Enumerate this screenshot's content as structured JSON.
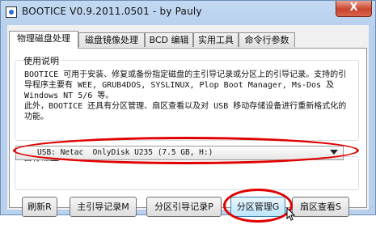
{
  "window": {
    "title": "BOOTICE V0.9.2011.0501 - by Pauly",
    "close_label": "X"
  },
  "tabs": [
    {
      "label": "物理磁盘处理",
      "active": true
    },
    {
      "label": "磁盘镜像处理",
      "active": false
    },
    {
      "label": "BCD 编辑",
      "active": false
    },
    {
      "label": "实用工具",
      "active": false
    },
    {
      "label": "命令行参数",
      "active": false
    }
  ],
  "usage": {
    "label": "使用说明",
    "text": "BOOTICE 可用于安装、修复或备份指定磁盘的主引导记录或分区上的引导记录。支持的引导程序主要有 WEE, GRUB4DOS, SYSLINUX, Plop Boot Manager, Ms-Dos 及 Windows NT 5/6 等。\n此外，BOOTICE 还具有分区管理、扇区查看以及对 USB 移动存储设备进行重新格式化的功能。"
  },
  "target_disk": {
    "label": "目标磁盘",
    "selected": "USB: Netac  OnlyDisk U235 (7.5 GB, H:)"
  },
  "buttons": {
    "refresh": "刷新R",
    "mbr": "主引导记录M",
    "pbr": "分区引导记录P",
    "parts_manage": "分区管理G",
    "sector_edit": "扇区查看S"
  },
  "colors": {
    "highlight_ring": "#e10000",
    "titlebar": "#b9d1ee",
    "close_button": "#c9452c"
  }
}
